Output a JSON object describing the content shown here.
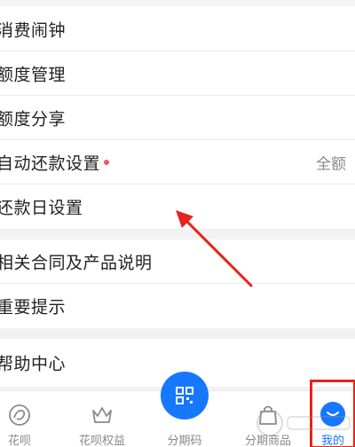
{
  "menu": {
    "items": [
      {
        "label": "消费闹钟"
      },
      {
        "label": "额度管理"
      },
      {
        "label": "额度分享"
      },
      {
        "label": "自动还款设置",
        "value": "全额"
      },
      {
        "label": "还款日设置"
      },
      {
        "label": "相关合同及产品说明"
      },
      {
        "label": "重要提示"
      },
      {
        "label": "帮助中心"
      }
    ]
  },
  "tabbar": {
    "tabs": [
      {
        "label": "花呗",
        "icon": "huabei-icon"
      },
      {
        "label": "花呗权益",
        "icon": "crown-icon"
      },
      {
        "label": "分期码",
        "icon": "qr-code-icon"
      },
      {
        "label": "分期商品",
        "icon": "shopping-bag-icon"
      },
      {
        "label": "我的",
        "icon": "mine-icon"
      }
    ],
    "active_index": 4
  },
  "colors": {
    "accent": "#1677ff",
    "annotation": "#e8231b",
    "dot": "#f2546b"
  }
}
